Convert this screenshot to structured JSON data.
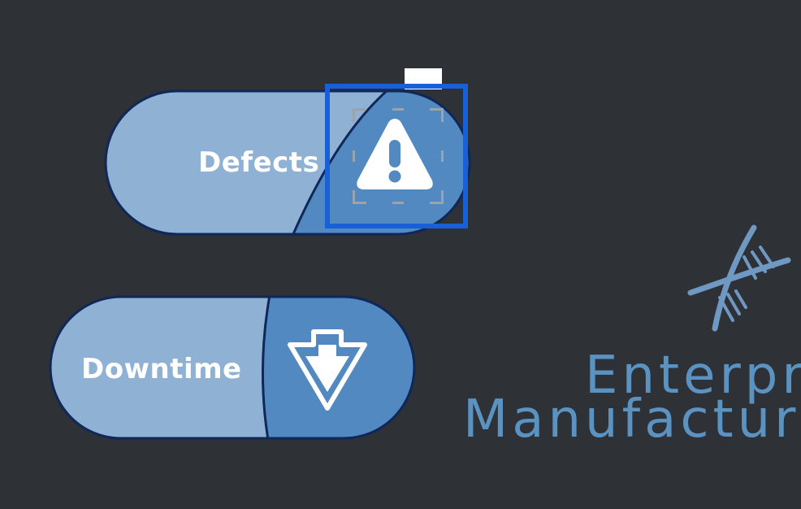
{
  "buttons": {
    "defects": {
      "label": "Defects",
      "icon": "warning-triangle-icon"
    },
    "downtime": {
      "label": "Downtime",
      "icon": "arrow-down-shield-icon"
    }
  },
  "brand": {
    "line1": "Enterpr",
    "line2": "Manufactur",
    "icon": "dna-helix-icon"
  },
  "colors": {
    "background": "#2e3136",
    "pill_light": "#8fb1d4",
    "pill_dark": "#5189c0",
    "pill_border": "#0f2759",
    "selection": "#1760d8",
    "brand_text": "#5a92c2"
  }
}
